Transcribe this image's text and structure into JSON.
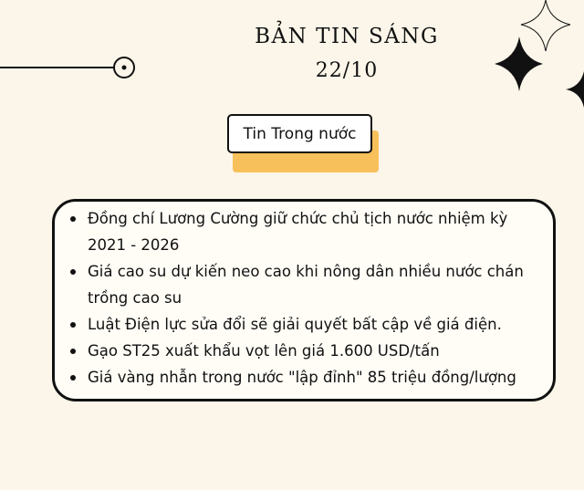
{
  "header": {
    "title": "BẢN TIN SÁNG",
    "date": "22/10"
  },
  "section": {
    "tag_label": "Tin Trong nước"
  },
  "news": {
    "items": [
      "Đồng chí Lương Cường giữ chức chủ tịch nước nhiệm kỳ 2021 - 2026",
      "Giá cao su dự kiến neo cao khi nông dân nhiều nước chán trồng cao su",
      "Luật Điện lực sửa đổi sẽ giải quyết bất cập về giá điện.",
      "Gạo ST25 xuất khẩu vọt lên giá 1.600 USD/tấn",
      "Giá vàng nhẫn trong nước \"lập đỉnh\" 85 triệu đồng/lượng"
    ]
  },
  "colors": {
    "background": "#fbf6e9",
    "accent": "#f7c05b",
    "ink": "#111111"
  },
  "icons": [
    "four-point-star-outline-icon",
    "four-point-star-filled-icon",
    "circle-target-icon"
  ]
}
